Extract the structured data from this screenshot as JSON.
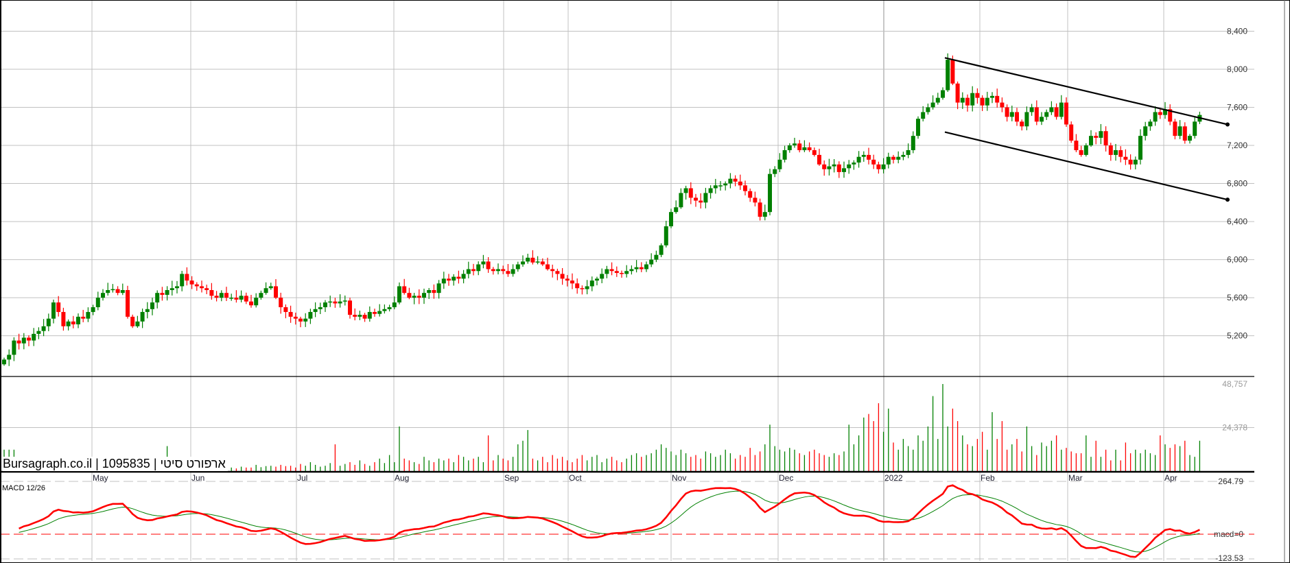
{
  "caption": "Bursagraph.co.il | 1095835 | ארפורט סיטי",
  "chart_data": {
    "type": "candlestick",
    "title": "Bursagraph.co.il | 1095835 | ארפורט סיטי",
    "price_axis": {
      "ticks": [
        "8,400",
        "8,000",
        "7,600",
        "7,200",
        "6,800",
        "6,400",
        "6,000",
        "5,600",
        "5,200"
      ],
      "tick_values": [
        8400,
        8000,
        7600,
        7200,
        6800,
        6400,
        6000,
        5600,
        5200
      ],
      "ylim": [
        4850,
        8800
      ]
    },
    "volume_axis": {
      "ticks": [
        "48,757",
        "24,378"
      ],
      "tick_values": [
        48757,
        24378
      ],
      "ylim": [
        0,
        48757
      ]
    },
    "macd": {
      "title": "MACD 12/26",
      "labels": [
        "264.79",
        "macd=0",
        "-123.53"
      ],
      "ylim": [
        -123.53,
        264.79
      ],
      "fast": 12,
      "slow": 26,
      "signal": 9
    },
    "x_labels": [
      "May",
      "Jun",
      "Jul",
      "Aug",
      "Sep",
      "Oct",
      "Nov",
      "Dec",
      "2022",
      "Feb",
      "Mar",
      "Apr"
    ],
    "x_label_index": [
      22,
      46,
      71,
      95,
      121,
      137,
      162,
      188,
      213,
      237,
      258,
      281
    ],
    "first_open": 4900,
    "close": [
      4950,
      5000,
      5150,
      5120,
      5180,
      5150,
      5220,
      5250,
      5300,
      5380,
      5550,
      5450,
      5300,
      5350,
      5320,
      5400,
      5380,
      5450,
      5500,
      5600,
      5650,
      5680,
      5690,
      5650,
      5680,
      5400,
      5300,
      5350,
      5450,
      5480,
      5550,
      5650,
      5630,
      5680,
      5700,
      5720,
      5850,
      5780,
      5740,
      5720,
      5700,
      5680,
      5620,
      5600,
      5650,
      5600,
      5600,
      5580,
      5620,
      5560,
      5520,
      5600,
      5650,
      5700,
      5720,
      5600,
      5500,
      5450,
      5400,
      5380,
      5350,
      5380,
      5450,
      5480,
      5500,
      5550,
      5560,
      5540,
      5560,
      5570,
      5420,
      5400,
      5420,
      5380,
      5450,
      5430,
      5460,
      5480,
      5500,
      5550,
      5720,
      5650,
      5600,
      5620,
      5600,
      5650,
      5680,
      5650,
      5750,
      5800,
      5780,
      5820,
      5800,
      5850,
      5900,
      5880,
      5950,
      5980,
      5900,
      5880,
      5900,
      5880,
      5850,
      5900,
      5950,
      5980,
      6020,
      5970,
      5980,
      5950,
      5900,
      5880,
      5850,
      5800,
      5780,
      5750,
      5700,
      5690,
      5720,
      5780,
      5800,
      5850,
      5900,
      5880,
      5860,
      5850,
      5880,
      5900,
      5920,
      5900,
      5950,
      6000,
      6050,
      6150,
      6350,
      6500,
      6550,
      6700,
      6750,
      6650,
      6620,
      6600,
      6700,
      6750,
      6780,
      6780,
      6800,
      6850,
      6820,
      6780,
      6720,
      6650,
      6600,
      6450,
      6500,
      6900,
      6950,
      7050,
      7150,
      7200,
      7220,
      7150,
      7180,
      7150,
      7100,
      7000,
      6950,
      6980,
      7000,
      6920,
      6960,
      7000,
      7020,
      7080,
      7100,
      7050,
      7000,
      6950,
      7000,
      7080,
      7050,
      7080,
      7100,
      7150,
      7300,
      7480,
      7550,
      7600,
      7650,
      7700,
      7780,
      8100,
      7850,
      7650,
      7700,
      7620,
      7750,
      7700,
      7620,
      7700,
      7720,
      7650,
      7600,
      7500,
      7550,
      7450,
      7400,
      7550,
      7600,
      7450,
      7500,
      7550,
      7600,
      7500,
      7650,
      7420,
      7250,
      7150,
      7100,
      7200,
      7300,
      7280,
      7350,
      7200,
      7100,
      7150,
      7080,
      7050,
      7000,
      7050,
      7300,
      7400,
      7450,
      7550,
      7520,
      7580,
      7450,
      7300,
      7400,
      7250,
      7300,
      7450,
      7520
    ],
    "volume": [
      12000,
      12000,
      12000,
      3000,
      2000,
      5000,
      2000,
      4000,
      6000,
      2000,
      2000,
      1000,
      3000,
      1500,
      2000,
      1000,
      800,
      1500,
      2000,
      1200,
      1000,
      900,
      2000,
      1500,
      900,
      1200,
      1000,
      2500,
      1000,
      1800,
      2200,
      1500,
      1300,
      14000,
      2000,
      1000,
      3000,
      1500,
      2000,
      1500,
      2500,
      2000,
      3000,
      2500,
      1800,
      3000,
      2000,
      1500,
      2500,
      2000,
      2000,
      3500,
      2200,
      2800,
      3000,
      2500,
      3500,
      2800,
      3000,
      2000,
      4000,
      3000,
      5000,
      3500,
      2500,
      3000,
      4500,
      15000,
      3000,
      4000,
      5000,
      3500,
      6000,
      4000,
      3000,
      5000,
      7000,
      4500,
      9000,
      5000,
      25000,
      7000,
      6000,
      5000,
      4000,
      8000,
      6000,
      5000,
      7000,
      6000,
      7000,
      5000,
      9000,
      8000,
      6000,
      7000,
      8000,
      5000,
      20000,
      6000,
      9000,
      7000,
      6000,
      8000,
      15000,
      17000,
      23000,
      7000,
      6000,
      8000,
      5000,
      9000,
      7000,
      8000,
      6000,
      5000,
      7000,
      9000,
      6000,
      8000,
      9000,
      5000,
      7000,
      8000,
      6000,
      5000,
      7000,
      9000,
      10000,
      8000,
      9000,
      10000,
      12000,
      15000,
      13000,
      11000,
      9000,
      12000,
      10000,
      8000,
      9000,
      7000,
      11000,
      10000,
      8000,
      9000,
      12000,
      10000,
      7000,
      9000,
      8000,
      13000,
      9000,
      11000,
      15000,
      26000,
      14000,
      12000,
      11000,
      13000,
      12000,
      10000,
      9000,
      11000,
      12000,
      10000,
      9000,
      8000,
      10000,
      9000,
      11000,
      26000,
      15000,
      20000,
      30000,
      32000,
      28000,
      38000,
      22000,
      35000,
      16000,
      12000,
      18000,
      14000,
      12000,
      20000,
      17000,
      25000,
      42000,
      18000,
      48757,
      25000,
      35000,
      28000,
      20000,
      15000,
      14000,
      18000,
      22000,
      12000,
      33000,
      18000,
      28000,
      12000,
      15000,
      18000,
      11000,
      25000,
      14000,
      9000,
      16000,
      14000,
      17000,
      20000,
      12000,
      13000,
      11000,
      10000,
      10000,
      20000,
      8000,
      17000,
      8000,
      12000,
      6000,
      12000,
      6000,
      16000,
      10000,
      12000,
      10000,
      12000,
      10000,
      9000,
      20000,
      15000,
      13000,
      15000,
      14000,
      17000,
      9000,
      8000,
      17000
    ],
    "colors": {
      "up": "#008000",
      "down": "#ff0000",
      "macd": "#ff0000",
      "signal": "#008000",
      "grid": "#c0c0c0"
    },
    "trend_channel": {
      "upper": [
        8120,
        7420
      ],
      "lower": [
        7340,
        6630
      ]
    },
    "grid": true
  }
}
